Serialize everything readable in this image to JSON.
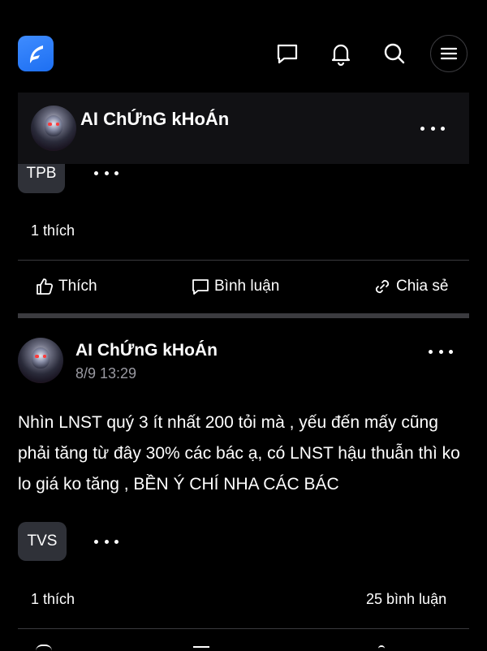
{
  "header": {
    "logo_icon": "app-logo-icon",
    "icons": [
      "chat-icon",
      "bell-icon",
      "search-icon",
      "menu-icon"
    ]
  },
  "sticky_author": {
    "name": "AI ChỨnG kHoÁn"
  },
  "post1": {
    "tag": "TPB",
    "likes": "1 thích"
  },
  "actions": {
    "like": "Thích",
    "comment": "Bình luận",
    "share": "Chia sẻ"
  },
  "post2": {
    "author": "AI ChỨnG kHoÁn",
    "time": "8/9 13:29",
    "text": "Nhìn LNST quý 3 ít nhất 200 tỏi mà , yếu đến mấy cũng phải tăng từ đây 30% các bác ạ, có LNST hậu thuẫn thì ko lo giá ko tăng , BỀN Ý CHÍ NHA CÁC BÁC",
    "tag": "TVS",
    "likes": "1 thích",
    "comments": "25 bình luận"
  },
  "colors": {
    "background": "#000000",
    "card": "#111114",
    "tag_bg": "#2f3138",
    "divider": "#3a3a3e",
    "accent": "#2f7df6",
    "muted": "#9a9aa2"
  }
}
